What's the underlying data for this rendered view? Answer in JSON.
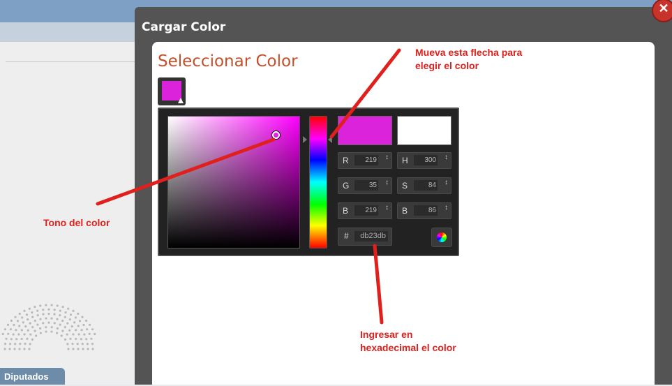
{
  "background": {
    "bottom_tab": "Diputados"
  },
  "dialog": {
    "title": "Cargar Color",
    "close_icon": "close-icon"
  },
  "content": {
    "heading": "Seleccionar Color"
  },
  "picker": {
    "selected_color": "#db23db",
    "current_color": "#ffffff",
    "fields": {
      "R": {
        "label": "R",
        "value": "219"
      },
      "G": {
        "label": "G",
        "value": "35"
      },
      "B": {
        "label": "B",
        "value": "219"
      },
      "H": {
        "label": "H",
        "value": "300"
      },
      "S": {
        "label": "S",
        "value": "84"
      },
      "B2": {
        "label": "B",
        "value": "86"
      }
    },
    "hex": {
      "label": "#",
      "value": "db23db"
    },
    "spinner_glyph": "↕",
    "wheel_icon": "color-wheel-icon"
  },
  "annotations": {
    "arrow_hint_line1": "Mueva esta flecha para",
    "arrow_hint_line2": "elegir el color",
    "tone_hint": "Tono del color",
    "hex_hint_line1": "Ingresar en",
    "hex_hint_line2": "hexadecimal el color",
    "color": "#e0201d"
  }
}
